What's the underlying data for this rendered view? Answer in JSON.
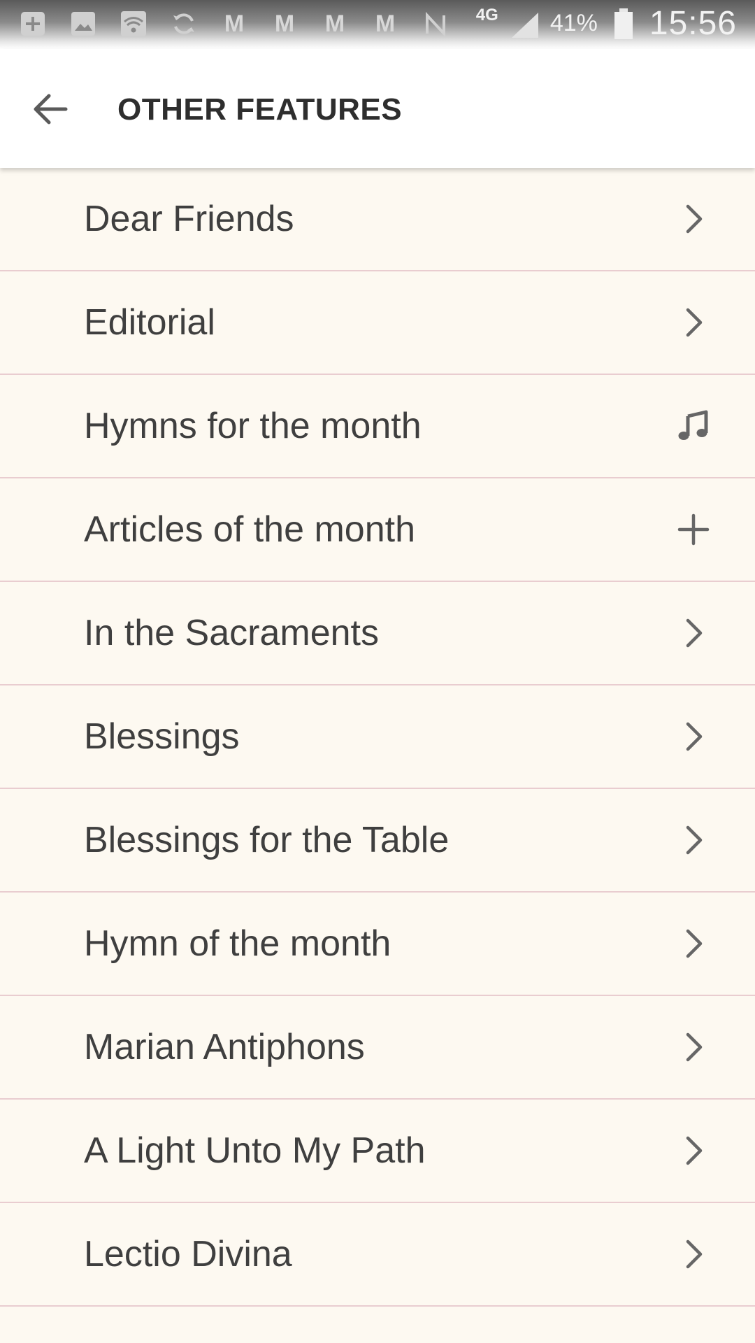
{
  "status_bar": {
    "left_icons": [
      "add-box-icon",
      "image-icon",
      "wifi-icon",
      "sync-icon"
    ],
    "m_labels": [
      "M",
      "M",
      "M",
      "M"
    ],
    "network_label": "4G",
    "battery": "41%",
    "time": "15:56"
  },
  "header": {
    "title": "OTHER FEATURES",
    "back_icon": "arrow-back-icon"
  },
  "colors": {
    "background": "#fdf9f1",
    "divider": "#e9cdd0",
    "text": "#3f3f3f",
    "icon": "#666666"
  },
  "items": [
    {
      "label": "Dear Friends",
      "icon": "chevron-right-icon"
    },
    {
      "label": "Editorial",
      "icon": "chevron-right-icon"
    },
    {
      "label": "Hymns for the month",
      "icon": "music-note-icon"
    },
    {
      "label": "Articles of the month",
      "icon": "plus-icon"
    },
    {
      "label": "In the Sacraments",
      "icon": "chevron-right-icon"
    },
    {
      "label": "Blessings",
      "icon": "chevron-right-icon"
    },
    {
      "label": "Blessings for the Table",
      "icon": "chevron-right-icon"
    },
    {
      "label": "Hymn of the month",
      "icon": "chevron-right-icon"
    },
    {
      "label": "Marian Antiphons",
      "icon": "chevron-right-icon"
    },
    {
      "label": "A Light Unto My Path",
      "icon": "chevron-right-icon"
    },
    {
      "label": "Lectio Divina",
      "icon": "chevron-right-icon"
    }
  ]
}
